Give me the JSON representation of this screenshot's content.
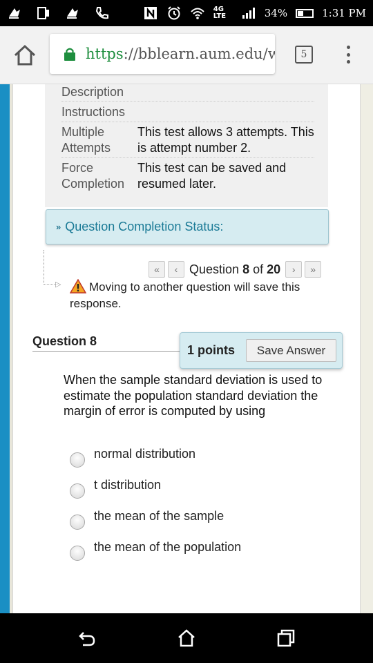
{
  "status_bar": {
    "battery": "34%",
    "time": "1:31 PM",
    "network": "4G LTE",
    "icons": [
      "notification-icon",
      "screen-icon",
      "notification-icon",
      "phone-icon",
      "nfc-icon",
      "alarm-icon",
      "wifi-icon",
      "signal-icon",
      "battery-icon"
    ]
  },
  "browser": {
    "url_scheme": "https",
    "url_rest": "://bblearn.aum.edu/webap",
    "tab_count": "5"
  },
  "test_info": {
    "rows": [
      {
        "label": "Description",
        "value": ""
      },
      {
        "label": "Instructions",
        "value": ""
      },
      {
        "label": "Multiple Attempts",
        "value": "This test allows 3 attempts. This is attempt number 2."
      },
      {
        "label": "Force Completion",
        "value": "This test can be saved and resumed later."
      }
    ]
  },
  "completion_status": {
    "label": "Question Completion Status:"
  },
  "navigation": {
    "prefix": "Question",
    "current": "8",
    "of_word": "of",
    "total": "20",
    "warning": "Moving to another question will save this response."
  },
  "question": {
    "title": "Question 8",
    "points": "1 points",
    "save_label": "Save Answer",
    "text": "When the sample standard deviation is used to estimate the population standard deviation the margin of error is computed by using",
    "options": [
      "normal distribution",
      "t distribution",
      "the mean of the sample",
      "the mean of the population"
    ]
  },
  "colors": {
    "accent": "#1a7a96",
    "panel": "#d6ecf1",
    "stripe": "#1a8fc4",
    "https_green": "#1e8e3e"
  }
}
